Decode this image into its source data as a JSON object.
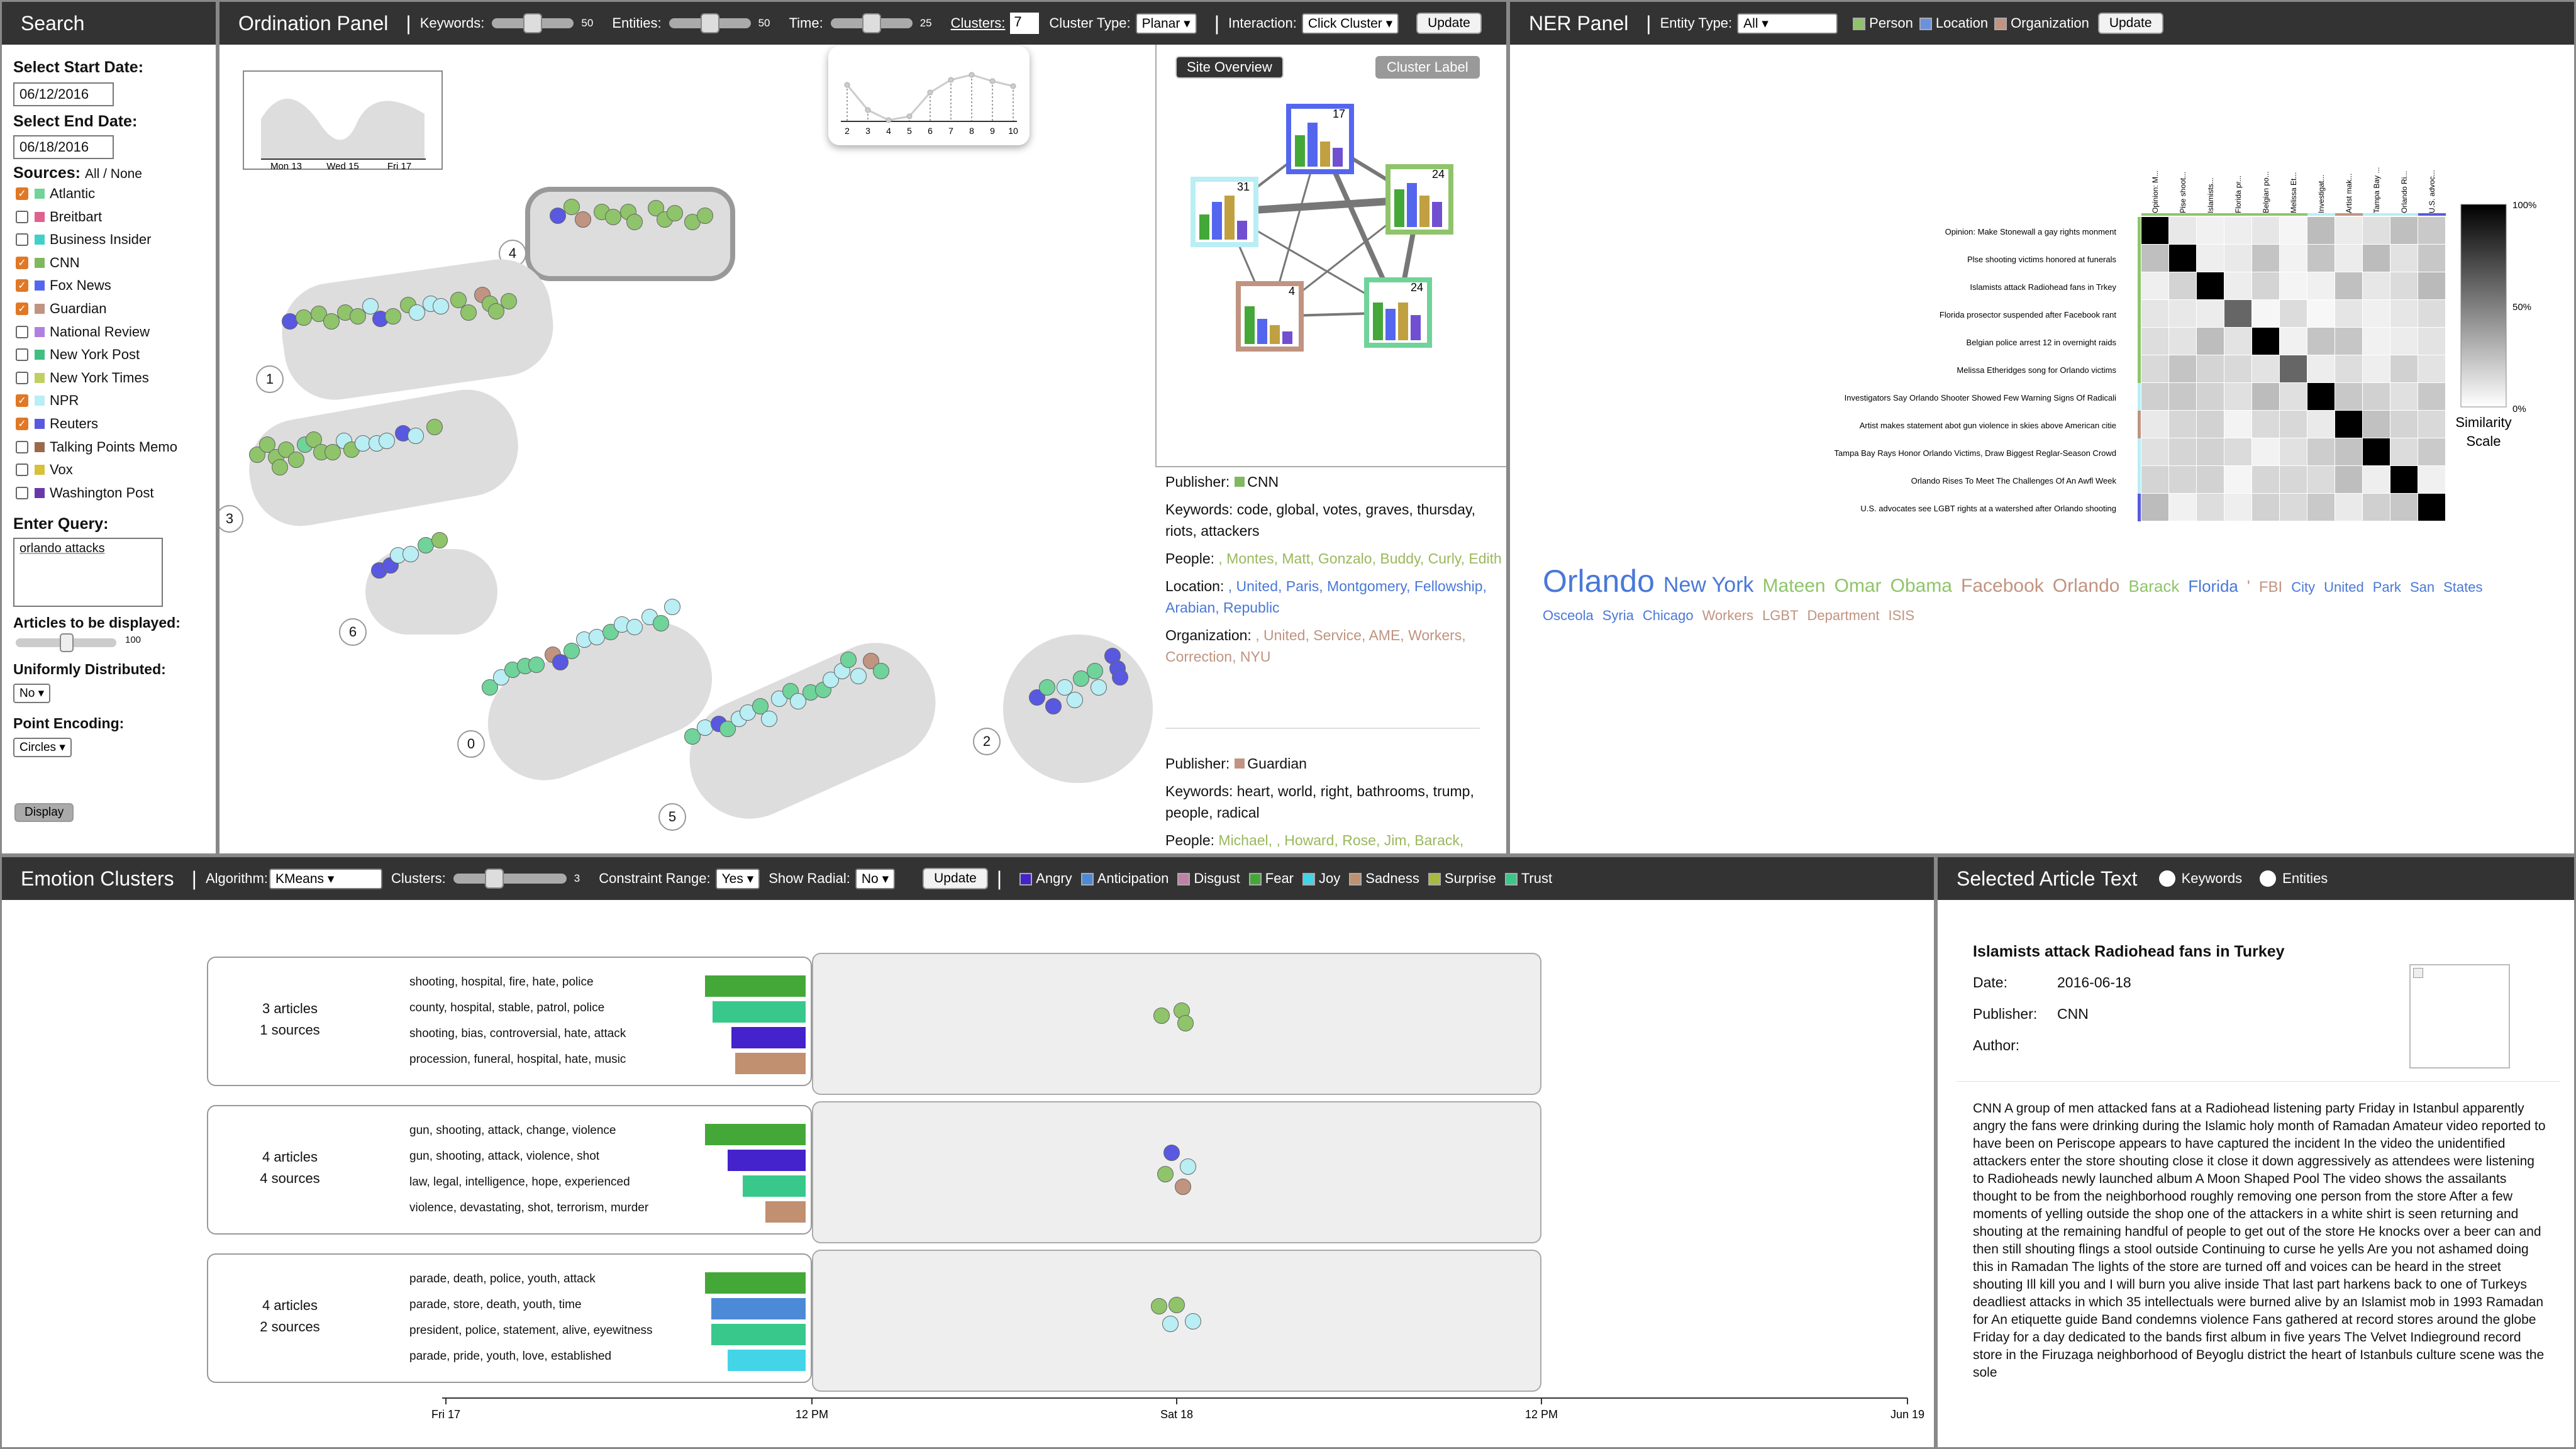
{
  "search": {
    "title": "Search",
    "start_label": "Select Start Date:",
    "start_value": "06/12/2016",
    "end_label": "Select End Date:",
    "end_value": "06/18/2016",
    "sources_label": "Sources:",
    "all_none": "All / None",
    "sources": [
      {
        "name": "Atlantic",
        "checked": true,
        "color": "#6fd39a"
      },
      {
        "name": "Breitbart",
        "checked": false,
        "color": "#e06090"
      },
      {
        "name": "Business Insider",
        "checked": false,
        "color": "#40d0c8"
      },
      {
        "name": "CNN",
        "checked": true,
        "color": "#7fb85e"
      },
      {
        "name": "Fox News",
        "checked": true,
        "color": "#5566ee"
      },
      {
        "name": "Guardian",
        "checked": true,
        "color": "#c09480"
      },
      {
        "name": "National Review",
        "checked": false,
        "color": "#b080e0"
      },
      {
        "name": "New York Post",
        "checked": false,
        "color": "#40c080"
      },
      {
        "name": "New York Times",
        "checked": false,
        "color": "#c0d060"
      },
      {
        "name": "NPR",
        "checked": true,
        "color": "#b8eef4"
      },
      {
        "name": "Reuters",
        "checked": true,
        "color": "#5858e0"
      },
      {
        "name": "Talking Points Memo",
        "checked": false,
        "color": "#9a6a4a"
      },
      {
        "name": "Vox",
        "checked": false,
        "color": "#d8c038"
      },
      {
        "name": "Washington Post",
        "checked": false,
        "color": "#6838a8"
      }
    ],
    "query_label": "Enter Query:",
    "query_value": "orlando attacks",
    "articles_label": "Articles to be displayed:",
    "articles_value": "100",
    "uniform_label": "Uniformly Distributed:",
    "uniform_value": "No",
    "encoding_label": "Point Encoding:",
    "encoding_value": "Circles",
    "display_btn": "Display"
  },
  "ordination": {
    "title": "Ordination Panel",
    "keywords_label": "Keywords:",
    "keywords_value": "50",
    "entities_label": "Entities:",
    "entities_value": "50",
    "time_label": "Time:",
    "time_value": "25",
    "clusters_label": "Clusters:",
    "clusters_value": "7",
    "cluster_type_label": "Cluster Type:",
    "cluster_type_value": "Planar",
    "interaction_label": "Interaction:",
    "interaction_value": "Click Cluster",
    "update_btn": "Update",
    "timeline_ticks": [
      "Mon 13",
      "Wed 15",
      "Fri 17"
    ],
    "cluster_numbers": [
      "4",
      "1",
      "3",
      "6",
      "0",
      "5",
      "2"
    ],
    "elbow_ticks": [
      "2",
      "3",
      "4",
      "5",
      "6",
      "7",
      "8",
      "9",
      "10"
    ],
    "site_overview_btn": "Site Overview",
    "cluster_label_btn": "Cluster Label",
    "site_counts": [
      "17",
      "31",
      "24",
      "4",
      "24"
    ],
    "articles": [
      {
        "publisher_label": "Publisher:",
        "publisher": "CNN",
        "publisher_color": "#7fb85e",
        "keywords_label": "Keywords:",
        "keywords": "code, global, votes, graves, thursday, riots, attackers",
        "people_label": "People:",
        "people": ", Montes, Matt, Gonzalo, Buddy, Curly, Edith",
        "location_label": "Location:",
        "location": ", United, Paris, Montgomery, Fellowship, Arabian, Republic",
        "org_label": "Organization:",
        "org": ", United, Service, AME, Workers, Correction, NYU"
      },
      {
        "publisher_label": "Publisher:",
        "publisher": "Guardian",
        "publisher_color": "#c09480",
        "keywords_label": "Keywords:",
        "keywords": "heart, world, right, bathrooms, trump, people, radical",
        "people_label": "People:",
        "people": "Michael, , Howard, Rose, Jim, Barack,"
      }
    ]
  },
  "ner": {
    "title": "NER Panel",
    "entity_type_label": "Entity Type:",
    "entity_type_value": "All",
    "legend": [
      {
        "label": "Person",
        "color": "#8fc46a"
      },
      {
        "label": "Location",
        "color": "#6a90e0"
      },
      {
        "label": "Organization",
        "color": "#c09480"
      }
    ],
    "update_btn": "Update",
    "col_labels": [
      "Opinion: M...",
      "Pise shoot...",
      "Islamists...",
      "Florida pr...",
      "Belgian po...",
      "Melissa Et...",
      "Investigat...",
      "Artist mak...",
      "Tampa Bay ...",
      "Orlando Ri...",
      "U.S. advoc..."
    ],
    "row_labels": [
      "Opinion: Make Stonewall a gay rights monment",
      "Plse shooting victims honored at funerals",
      "Islamists attack Radiohead fans in Trkey",
      "Florida prosector suspended after Facebook rant",
      "Belgian police arrest 12 in overnight raids",
      "Melissa Etheridges song for Orlando victims",
      "Investigators Say Orlando Shooter Showed Few Warning Signs Of Radicali",
      "Artist makes statement abot gun violence in skies above American citie",
      "Tampa Bay Rays Honor Orlando Victims, Draw Biggest Reglar-Season Crowd",
      "Orlando Rises To Meet The Challenges Of An Awfl Week",
      "U.S. advocates see LGBT rights at a watershed after Orlando shooting"
    ],
    "scale_ticks": [
      "100%",
      "50%",
      "0%"
    ],
    "scale_title": "Similarity Scale",
    "words": [
      {
        "w": "Orlando",
        "c": "#4a78d8",
        "s": 50
      },
      {
        "w": "New York",
        "c": "#4a78d8",
        "s": 34
      },
      {
        "w": "Mateen",
        "c": "#8fc46a",
        "s": 30
      },
      {
        "w": "Omar",
        "c": "#8fc46a",
        "s": 30
      },
      {
        "w": "Obama",
        "c": "#8fc46a",
        "s": 30
      },
      {
        "w": "Facebook",
        "c": "#c09480",
        "s": 30
      },
      {
        "w": "Orlando",
        "c": "#c09480",
        "s": 30
      },
      {
        "w": "Barack",
        "c": "#8fc46a",
        "s": 26
      },
      {
        "w": "Florida",
        "c": "#4a78d8",
        "s": 26
      },
      {
        "w": "'",
        "c": "#c09480",
        "s": 26
      },
      {
        "w": "FBI",
        "c": "#c09480",
        "s": 24
      },
      {
        "w": "City",
        "c": "#4a78d8",
        "s": 22
      },
      {
        "w": "United",
        "c": "#4a78d8",
        "s": 22
      },
      {
        "w": "Park",
        "c": "#4a78d8",
        "s": 22
      },
      {
        "w": "San",
        "c": "#4a78d8",
        "s": 22
      },
      {
        "w": "States",
        "c": "#4a78d8",
        "s": 22
      },
      {
        "w": "Osceola",
        "c": "#4a78d8",
        "s": 22
      },
      {
        "w": "Syria",
        "c": "#4a78d8",
        "s": 22
      },
      {
        "w": "Chicago",
        "c": "#4a78d8",
        "s": 22
      },
      {
        "w": "Workers",
        "c": "#c09480",
        "s": 22
      },
      {
        "w": "LGBT",
        "c": "#c09480",
        "s": 22
      },
      {
        "w": "Department",
        "c": "#c09480",
        "s": 22
      },
      {
        "w": "ISIS",
        "c": "#c09480",
        "s": 22
      }
    ]
  },
  "emotion": {
    "title": "Emotion Clusters",
    "algorithm_label": "Algorithm:",
    "algorithm_value": "KMeans",
    "clusters_label": "Clusters:",
    "clusters_value": "3",
    "constraint_label": "Constraint Range:",
    "constraint_value": "Yes",
    "radial_label": "Show Radial:",
    "radial_value": "No",
    "update_btn": "Update",
    "legend": [
      {
        "label": "Angry",
        "color": "#4422cc"
      },
      {
        "label": "Anticipation",
        "color": "#4c8ad8"
      },
      {
        "label": "Disgust",
        "color": "#c080a8"
      },
      {
        "label": "Fear",
        "color": "#44a838"
      },
      {
        "label": "Joy",
        "color": "#44d4e8"
      },
      {
        "label": "Sadness",
        "color": "#c09070"
      },
      {
        "label": "Surprise",
        "color": "#a8b840"
      },
      {
        "label": "Trust",
        "color": "#38c88c"
      }
    ],
    "rows": [
      {
        "articles": "3 articles",
        "sources": "1 sources",
        "keywords": [
          "shooting, hospital, fire, hate, police",
          "county, hospital, stable, patrol, police",
          "shooting, bias, controversial, hate, attack",
          "procession, funeral, hospital, hate, music"
        ],
        "bars": [
          {
            "c": "#44a838",
            "w": 160
          },
          {
            "c": "#38c88c",
            "w": 148
          },
          {
            "c": "#4422cc",
            "w": 118
          },
          {
            "c": "#c09070",
            "w": 112
          }
        ]
      },
      {
        "articles": "4 articles",
        "sources": "4 sources",
        "keywords": [
          "gun, shooting, attack, change, violence",
          "gun, shooting, attack, violence, shot",
          "law, legal, intelligence, hope, experienced",
          "violence, devastating, shot, terrorism, murder"
        ],
        "bars": [
          {
            "c": "#44a838",
            "w": 160
          },
          {
            "c": "#4422cc",
            "w": 124
          },
          {
            "c": "#38c88c",
            "w": 100
          },
          {
            "c": "#c09070",
            "w": 64
          }
        ]
      },
      {
        "articles": "4 articles",
        "sources": "2 sources",
        "keywords": [
          "parade, death, police, youth, attack",
          "parade, store, death, youth, time",
          "president, police, statement, alive, eyewitness",
          "parade, pride, youth, love, established"
        ],
        "bars": [
          {
            "c": "#44a838",
            "w": 160
          },
          {
            "c": "#4c8ad8",
            "w": 150
          },
          {
            "c": "#38c88c",
            "w": 150
          },
          {
            "c": "#44d4e8",
            "w": 124
          }
        ]
      }
    ],
    "axis_ticks": [
      "Fri 17",
      "12 PM",
      "Sat 18",
      "12 PM",
      "Jun 19"
    ]
  },
  "article": {
    "title": "Selected Article Text",
    "opt_keywords": "Keywords",
    "opt_entities": "Entities",
    "headline": "Islamists attack Radiohead fans in Turkey",
    "date_label": "Date:",
    "date": "2016-06-18",
    "publisher_label": "Publisher:",
    "publisher": "CNN",
    "author_label": "Author:",
    "author": "",
    "body": "CNN A group of men attacked fans at a Radiohead listening party Friday in Istanbul apparently angry the fans were drinking during the Islamic holy month of Ramadan Amateur video reported to have been on Periscope appears to have captured the incident In the video the unidentified attackers enter the store shouting close it close it down aggressively as attendees were listening to Radioheads newly launched album A Moon Shaped Pool The video shows the assailants thought to be from the neighborhood roughly removing one person from the store After a few moments of yelling outside the shop one of the attackers in a white shirt is seen returning and shouting at the remaining handful of people to get out of the store He knocks over a beer can and then still shouting flings a stool outside Continuing to curse he yells Are you not ashamed doing this in Ramadan The lights of the store are turned off and voices can be heard in the street shouting Ill kill you and I will burn you alive inside That last part harkens back to one of Turkeys deadliest attacks in which 35 intellectuals were burned alive by an Islamist mob in 1993 Ramadan for An etiquette guide Band condemns violence Fans gathered at record stores around the globe Friday for a day dedicated to the bands first album in five years The Velvet Indieground record store in the Firuzaga neighborhood of Beyoglu district the heart of Istanbuls culture scene was the sole"
  }
}
